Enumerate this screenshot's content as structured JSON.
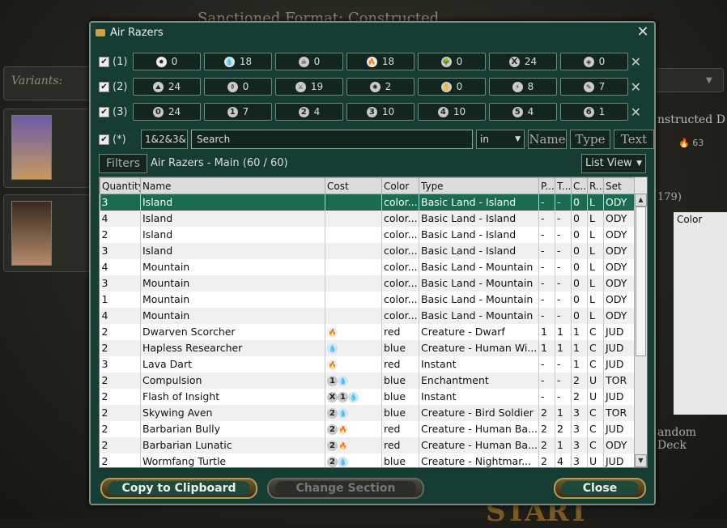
{
  "background": {
    "format_text": "Sanctioned Format: Constructed",
    "variants_label": "Variants:",
    "constructed_label": "nstructed D",
    "count_label": "179)",
    "color_header": "Color",
    "random_deck": "andom Deck",
    "start": "START",
    "cost_63": "63"
  },
  "dialog": {
    "title": "Air Razers",
    "filter_rows": [
      {
        "label": "(1)",
        "items": [
          {
            "icon": "white-mana-icon",
            "glyph": "✹",
            "cls": "c-w",
            "count": "0"
          },
          {
            "icon": "blue-mana-icon",
            "glyph": "💧",
            "cls": "c-u",
            "count": "18"
          },
          {
            "icon": "black-mana-icon",
            "glyph": "☠",
            "cls": "c-b",
            "count": "0"
          },
          {
            "icon": "red-mana-icon",
            "glyph": "🔥",
            "cls": "c-r",
            "count": "18"
          },
          {
            "icon": "green-mana-icon",
            "glyph": "🌳",
            "cls": "c-g",
            "count": "0"
          },
          {
            "icon": "colorless-x-icon",
            "glyph": "X",
            "cls": "c-n",
            "count": "24"
          },
          {
            "icon": "multicolor-icon",
            "glyph": "◈",
            "cls": "c-g",
            "count": "0"
          }
        ]
      },
      {
        "label": "(2)",
        "items": [
          {
            "icon": "land-icon",
            "glyph": "⛰",
            "cls": "c-g",
            "count": "24"
          },
          {
            "icon": "artifact-icon",
            "glyph": "⚱",
            "cls": "c-g",
            "count": "0"
          },
          {
            "icon": "creature-icon",
            "glyph": "⚔",
            "cls": "c-g",
            "count": "19"
          },
          {
            "icon": "enchantment-icon",
            "glyph": "✺",
            "cls": "c-g",
            "count": "2"
          },
          {
            "icon": "planeswalker-icon",
            "glyph": "✋",
            "cls": "c-g",
            "count": "0"
          },
          {
            "icon": "instant-icon",
            "glyph": "⚡",
            "cls": "c-g",
            "count": "8"
          },
          {
            "icon": "sorcery-icon",
            "glyph": "✎",
            "cls": "c-g",
            "count": "7"
          }
        ]
      },
      {
        "label": "(3)",
        "items": [
          {
            "icon": "cmc-0-icon",
            "glyph": "0",
            "cls": "c-n",
            "count": "24"
          },
          {
            "icon": "cmc-1-icon",
            "glyph": "1",
            "cls": "c-n",
            "count": "7"
          },
          {
            "icon": "cmc-2-icon",
            "glyph": "2",
            "cls": "c-n",
            "count": "4"
          },
          {
            "icon": "cmc-3-icon",
            "glyph": "3",
            "cls": "c-n",
            "count": "10"
          },
          {
            "icon": "cmc-4-icon",
            "glyph": "4",
            "cls": "c-n",
            "count": "10"
          },
          {
            "icon": "cmc-5-icon",
            "glyph": "5",
            "cls": "c-n",
            "count": "4"
          },
          {
            "icon": "cmc-6-icon",
            "glyph": "6",
            "cls": "c-n",
            "count": "1"
          }
        ]
      }
    ],
    "search_row": {
      "label": "(*)",
      "mode": "1&2&3&",
      "placeholder": "Search",
      "in_select": "in",
      "name_btn": "Name",
      "type_btn": "Type",
      "text_btn": "Text"
    },
    "filters_button": "Filters",
    "deck_title": "Air Razers - Main (60 / 60)",
    "view_select": "List View",
    "columns": [
      "Quantity",
      "Name",
      "Cost",
      "Color",
      "Type",
      "P...",
      "T...",
      "C...",
      "R...",
      "Set"
    ],
    "rows": [
      {
        "q": "3",
        "name": "Island",
        "cost": [],
        "color": "color...",
        "type": "Basic Land - Island",
        "p": "-",
        "t": "-",
        "c": "0",
        "r": "L",
        "set": "ODY"
      },
      {
        "q": "4",
        "name": "Island",
        "cost": [],
        "color": "color...",
        "type": "Basic Land - Island",
        "p": "-",
        "t": "-",
        "c": "0",
        "r": "L",
        "set": "ODY"
      },
      {
        "q": "2",
        "name": "Island",
        "cost": [],
        "color": "color...",
        "type": "Basic Land - Island",
        "p": "-",
        "t": "-",
        "c": "0",
        "r": "L",
        "set": "ODY"
      },
      {
        "q": "3",
        "name": "Island",
        "cost": [],
        "color": "color...",
        "type": "Basic Land - Island",
        "p": "-",
        "t": "-",
        "c": "0",
        "r": "L",
        "set": "ODY"
      },
      {
        "q": "4",
        "name": "Mountain",
        "cost": [],
        "color": "color...",
        "type": "Basic Land - Mountain",
        "p": "-",
        "t": "-",
        "c": "0",
        "r": "L",
        "set": "ODY"
      },
      {
        "q": "3",
        "name": "Mountain",
        "cost": [],
        "color": "color...",
        "type": "Basic Land - Mountain",
        "p": "-",
        "t": "-",
        "c": "0",
        "r": "L",
        "set": "ODY"
      },
      {
        "q": "1",
        "name": "Mountain",
        "cost": [],
        "color": "color...",
        "type": "Basic Land - Mountain",
        "p": "-",
        "t": "-",
        "c": "0",
        "r": "L",
        "set": "ODY"
      },
      {
        "q": "4",
        "name": "Mountain",
        "cost": [],
        "color": "color...",
        "type": "Basic Land - Mountain",
        "p": "-",
        "t": "-",
        "c": "0",
        "r": "L",
        "set": "ODY"
      },
      {
        "q": "2",
        "name": "Dwarven Scorcher",
        "cost": [
          "R"
        ],
        "color": "red",
        "type": "Creature - Dwarf",
        "p": "1",
        "t": "1",
        "c": "1",
        "r": "C",
        "set": "JUD"
      },
      {
        "q": "2",
        "name": "Hapless Researcher",
        "cost": [
          "U"
        ],
        "color": "blue",
        "type": "Creature - Human Wi...",
        "p": "1",
        "t": "1",
        "c": "1",
        "r": "C",
        "set": "JUD"
      },
      {
        "q": "3",
        "name": "Lava Dart",
        "cost": [
          "R"
        ],
        "color": "red",
        "type": "Instant",
        "p": "-",
        "t": "-",
        "c": "1",
        "r": "C",
        "set": "JUD"
      },
      {
        "q": "2",
        "name": "Compulsion",
        "cost": [
          "1",
          "U"
        ],
        "color": "blue",
        "type": "Enchantment",
        "p": "-",
        "t": "-",
        "c": "2",
        "r": "U",
        "set": "TOR"
      },
      {
        "q": "2",
        "name": "Flash of Insight",
        "cost": [
          "X",
          "1",
          "U"
        ],
        "color": "blue",
        "type": "Instant",
        "p": "-",
        "t": "-",
        "c": "2",
        "r": "U",
        "set": "JUD"
      },
      {
        "q": "2",
        "name": "Skywing Aven",
        "cost": [
          "2",
          "U"
        ],
        "color": "blue",
        "type": "Creature - Bird Soldier",
        "p": "2",
        "t": "1",
        "c": "3",
        "r": "C",
        "set": "TOR"
      },
      {
        "q": "2",
        "name": "Barbarian Bully",
        "cost": [
          "2",
          "R"
        ],
        "color": "red",
        "type": "Creature - Human Ba...",
        "p": "2",
        "t": "2",
        "c": "3",
        "r": "C",
        "set": "JUD"
      },
      {
        "q": "2",
        "name": "Barbarian Lunatic",
        "cost": [
          "2",
          "R"
        ],
        "color": "red",
        "type": "Creature - Human Ba...",
        "p": "2",
        "t": "1",
        "c": "3",
        "r": "C",
        "set": "ODY"
      },
      {
        "q": "2",
        "name": "Wormfang Turtle",
        "cost": [
          "2",
          "U"
        ],
        "color": "blue",
        "type": "Creature - Nightmar...",
        "p": "2",
        "t": "4",
        "c": "3",
        "r": "U",
        "set": "JUD"
      }
    ],
    "buttons": {
      "copy": "Copy to Clipboard",
      "change_section": "Change Section",
      "close": "Close"
    }
  }
}
